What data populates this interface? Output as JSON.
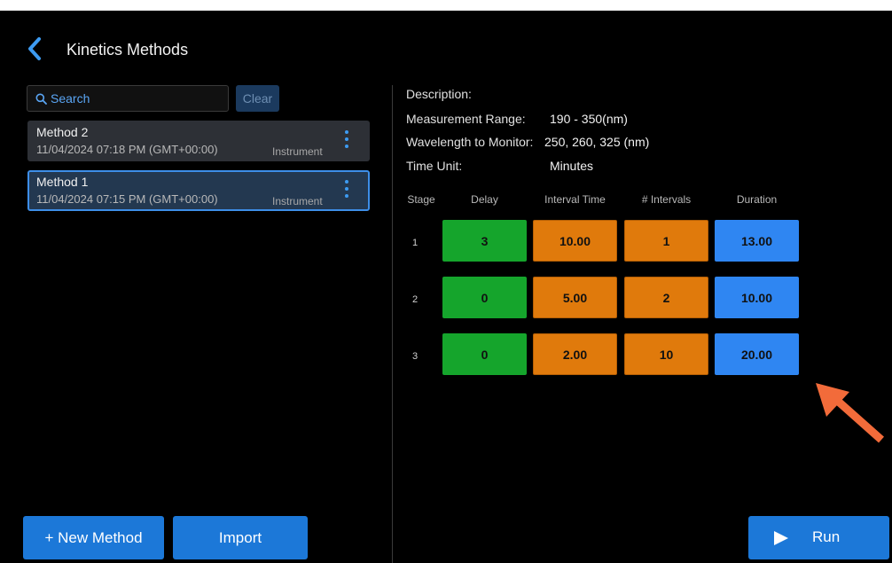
{
  "header": {
    "title": "Kinetics Methods",
    "back_icon": "chevron-left-icon"
  },
  "search": {
    "placeholder": "Search",
    "value": "",
    "clear_label": "Clear"
  },
  "methods": [
    {
      "name": "Method 2",
      "date": "11/04/2024 07:18 PM (GMT+00:00)",
      "source": "Instrument",
      "selected": false
    },
    {
      "name": "Method 1",
      "date": "11/04/2024 07:15 PM (GMT+00:00)",
      "source": "Instrument",
      "selected": true
    }
  ],
  "buttons": {
    "new_method": "+ New Method",
    "import": "Import",
    "run": "Run"
  },
  "details": {
    "description_label": "Description:",
    "description_value": "",
    "range_label": "Measurement Range:",
    "range_value": "190 - 350(nm)",
    "wavelength_label": "Wavelength to Monitor:",
    "wavelength_value": "250, 260, 325 (nm)",
    "time_unit_label": "Time Unit:",
    "time_unit_value": "Minutes"
  },
  "table": {
    "headers": {
      "stage": "Stage",
      "delay": "Delay",
      "interval": "Interval Time",
      "count": "# Intervals",
      "duration": "Duration"
    },
    "rows": [
      {
        "stage": "1",
        "delay": "3",
        "interval": "10.00",
        "count": "1",
        "duration": "13.00"
      },
      {
        "stage": "2",
        "delay": "0",
        "interval": "5.00",
        "count": "2",
        "duration": "10.00"
      },
      {
        "stage": "3",
        "delay": "0",
        "interval": "2.00",
        "count": "10",
        "duration": "20.00"
      }
    ]
  },
  "colors": {
    "background": "#000000",
    "accent": "#1c78d8",
    "delay": "#15a52c",
    "interval": "#e07a0c",
    "duration": "#2f86f2",
    "annotation_arrow": "#f26b3a"
  }
}
